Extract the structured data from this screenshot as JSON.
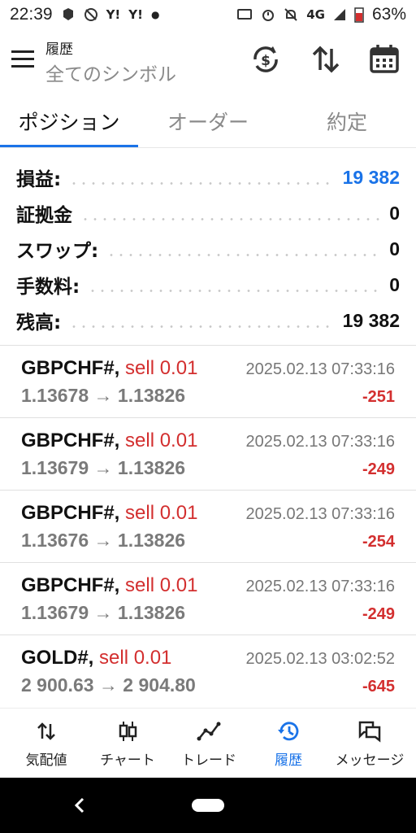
{
  "status_bar": {
    "time": "22:39",
    "left_badges": [
      "Y!",
      "Y!"
    ],
    "network": "4G",
    "battery": "63%"
  },
  "header": {
    "subtitle": "履歴",
    "title": "全てのシンボル"
  },
  "tabs": [
    {
      "label": "ポジション",
      "active": true
    },
    {
      "label": "オーダー",
      "active": false
    },
    {
      "label": "約定",
      "active": false
    }
  ],
  "summary": [
    {
      "label": "損益:",
      "value": "19 382",
      "highlight": true
    },
    {
      "label": "証拠金",
      "value": "0",
      "highlight": false
    },
    {
      "label": "スワップ:",
      "value": "0",
      "highlight": false
    },
    {
      "label": "手数料:",
      "value": "0",
      "highlight": false
    },
    {
      "label": "残高:",
      "value": "19 382",
      "highlight": false
    }
  ],
  "trades": [
    {
      "symbol": "GBPCHF#,",
      "side": "sell 0.01",
      "datetime": "2025.02.13 07:33:16",
      "prices": "1.13678 → 1.13826",
      "profit": "-251"
    },
    {
      "symbol": "GBPCHF#,",
      "side": "sell 0.01",
      "datetime": "2025.02.13 07:33:16",
      "prices": "1.13679 → 1.13826",
      "profit": "-249"
    },
    {
      "symbol": "GBPCHF#,",
      "side": "sell 0.01",
      "datetime": "2025.02.13 07:33:16",
      "prices": "1.13676 → 1.13826",
      "profit": "-254"
    },
    {
      "symbol": "GBPCHF#,",
      "side": "sell 0.01",
      "datetime": "2025.02.13 07:33:16",
      "prices": "1.13679 → 1.13826",
      "profit": "-249"
    },
    {
      "symbol": "GOLD#,",
      "side": "sell 0.01",
      "datetime": "2025.02.13 03:02:52",
      "prices": "2 900.63 → 2 904.80",
      "profit": "-645"
    }
  ],
  "bottom_nav": [
    {
      "label": "気配値",
      "icon": "quotes-icon",
      "active": false
    },
    {
      "label": "チャート",
      "icon": "candlestick-icon",
      "active": false
    },
    {
      "label": "トレード",
      "icon": "trend-icon",
      "active": false
    },
    {
      "label": "履歴",
      "icon": "history-icon",
      "active": true
    },
    {
      "label": "メッセージ",
      "icon": "messages-icon",
      "active": false
    }
  ],
  "colors": {
    "accent": "#1a73e8",
    "loss": "#d32f2f"
  }
}
